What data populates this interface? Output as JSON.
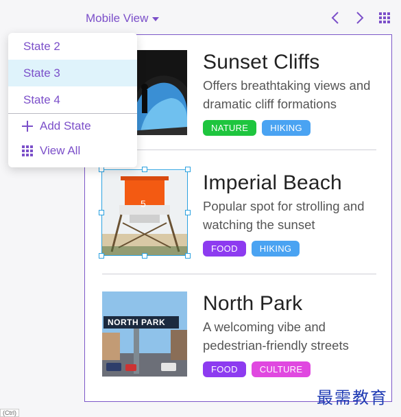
{
  "toolbar": {
    "view_label": "Mobile View",
    "prev_icon": "chevron-left-icon",
    "next_icon": "chevron-right-icon",
    "grid_icon": "grid-icon"
  },
  "dropdown": {
    "states": [
      {
        "label": "State 2",
        "active": false
      },
      {
        "label": "State 3",
        "active": true
      },
      {
        "label": "State 4",
        "active": false
      }
    ],
    "add_state": "Add State",
    "view_all": "View All"
  },
  "cards": [
    {
      "title": "Sunset Cliffs",
      "description": "Offers breathtaking views and dramatic cliff formations",
      "tags": [
        {
          "label": "NATURE",
          "color": "#1ec53e"
        },
        {
          "label": "HIKING",
          "color": "#4aa3f2"
        }
      ]
    },
    {
      "title": "Imperial Beach",
      "description": "Popular spot for strolling and watching the sunset",
      "image_text": "5",
      "tags": [
        {
          "label": "FOOD",
          "color": "#8d3bf0"
        },
        {
          "label": "HIKING",
          "color": "#4aa3f2"
        }
      ]
    },
    {
      "title": "North Park",
      "description": "A welcoming vibe and pedestrian-friendly streets",
      "image_text": "NORTH PARK",
      "tags": [
        {
          "label": "FOOD",
          "color": "#8d3bf0"
        },
        {
          "label": "CULTURE",
          "color": "#e048e0"
        }
      ]
    }
  ],
  "colors": {
    "accent": "#7b4fc9",
    "selection": "#2aa1e0",
    "active_state_bg": "#dff3fb"
  },
  "watermark": "最需教育",
  "corner_label": "(Ctrl)"
}
